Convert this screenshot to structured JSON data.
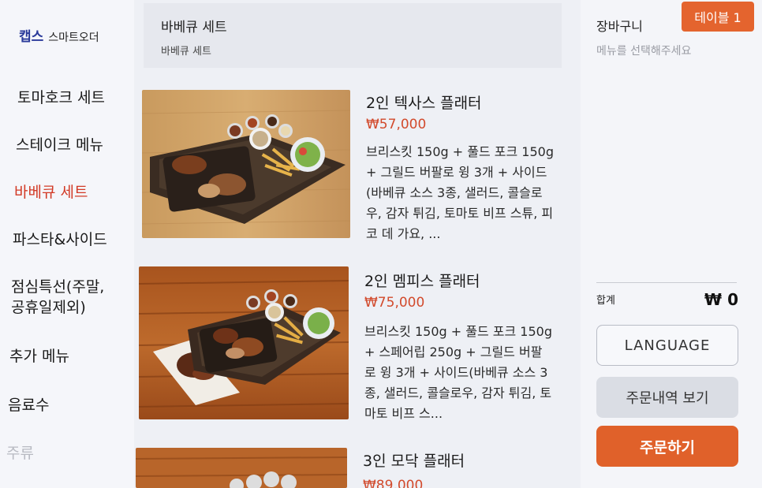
{
  "brand": {
    "name": "캡스",
    "sub": "스마트오더"
  },
  "sidebar": {
    "items": [
      {
        "label": "토마호크 세트"
      },
      {
        "label": "스테이크 메뉴"
      },
      {
        "label": "바베큐 세트"
      },
      {
        "label": "파스타&사이드"
      },
      {
        "label": "점심특선(주말,"
      },
      {
        "label": "공휴일제외)"
      },
      {
        "label": "추가 메뉴"
      },
      {
        "label": "음료수"
      },
      {
        "label": "주류"
      }
    ]
  },
  "category": {
    "title": "바베큐 세트",
    "subtitle": "바베큐 세트"
  },
  "menu": [
    {
      "name": "2인 텍사스 플래터",
      "price": "₩57,000",
      "desc": "브리스킷 150g + 풀드 포크 150g + 그릴드 버팔로 윙 3개 + 사이드(바베큐 소스 3종, 샐러드, 콜슬로우, 감자 튀김, 토마토 비프 스튜, 피코 데 가요, ..."
    },
    {
      "name": "2인 멤피스 플래터",
      "price": "₩75,000",
      "desc": "브리스킷 150g + 풀드 포크 150g + 스페어립 250g + 그릴드 버팔로 윙 3개 + 사이드(바베큐 소스 3종, 샐러드, 콜슬로우, 감자 튀김, 토마토 비프 스..."
    },
    {
      "name": "3인 모닥 플래터",
      "price": "₩89,000",
      "desc": ""
    }
  ],
  "cart": {
    "title": "장바구니",
    "empty_text": "메뉴를 선택해주세요",
    "table_label": "테이블 1",
    "total_label": "합계",
    "total_value": "₩ 0",
    "language_button": "LANGUAGE",
    "history_button": "주문내역 보기",
    "order_button": "주문하기"
  },
  "colors": {
    "accent": "#e0612a",
    "active_category": "#d23a26",
    "price": "#d24a2c"
  }
}
